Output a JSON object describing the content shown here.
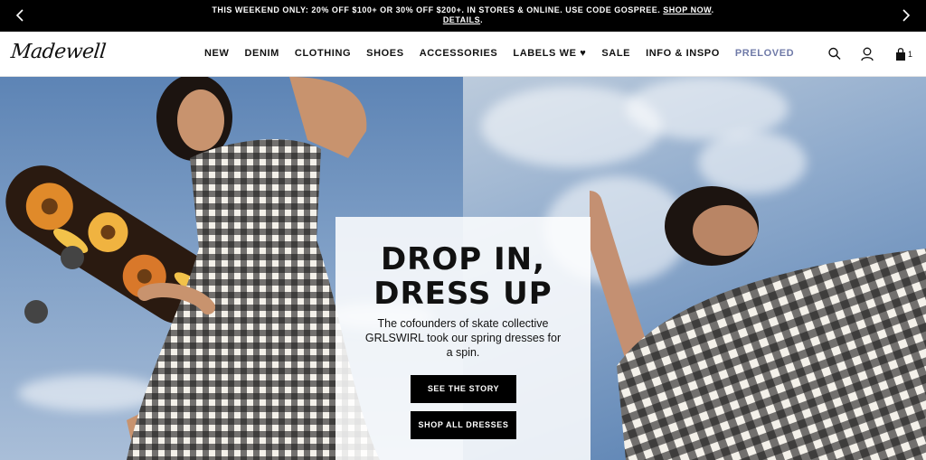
{
  "promo": {
    "text": "THIS WEEKEND ONLY: 20% OFF $100+ OR 30% OFF $200+. IN STORES & ONLINE. USE CODE GOSPREE.",
    "shop_now": "SHOP NOW",
    "details": "DETAILS",
    "separator": ".",
    "prev_icon": "chevron-left-icon",
    "next_icon": "chevron-right-icon"
  },
  "header": {
    "logo": "Madewell",
    "nav": [
      {
        "label": "NEW"
      },
      {
        "label": "DENIM"
      },
      {
        "label": "CLOTHING"
      },
      {
        "label": "SHOES"
      },
      {
        "label": "ACCESSORIES"
      },
      {
        "label": "LABELS WE ♥"
      },
      {
        "label": "SALE"
      },
      {
        "label": "INFO & INSPO"
      },
      {
        "label": "PRELOVED"
      }
    ],
    "icons": [
      "search-icon",
      "account-icon",
      "bag-icon"
    ],
    "bag_count": "1",
    "preloved_color": "#6f7aa8"
  },
  "hero": {
    "headline_line1": "DROP IN,",
    "headline_line2": "DRESS UP",
    "body": "The cofounders of skate collective GRLSWIRL took our spring dresses for a spin.",
    "cta_story": "SEE THE STORY",
    "cta_dresses": "SHOP ALL DRESSES"
  }
}
